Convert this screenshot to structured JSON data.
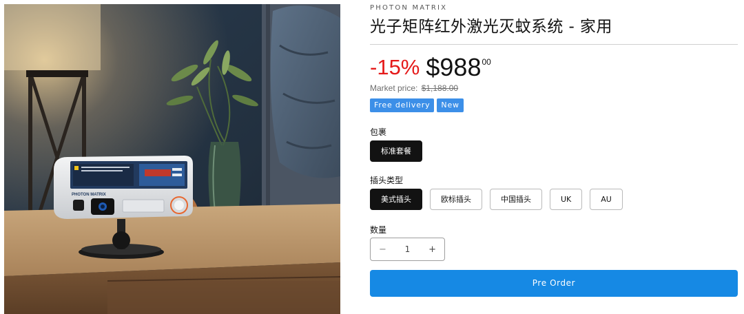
{
  "product": {
    "vendor": "PHOTON MATRIX",
    "title": "光子矩阵红外激光灭蚊系统 - 家用",
    "image_alt": "Photon Matrix device on a bedside table",
    "device_brand_text": "PHOTON MATRIX"
  },
  "price": {
    "discount": "-15%",
    "amount": "$988",
    "cents": "00",
    "market_label": "Market price:",
    "market_value": "$1,188.00"
  },
  "badges": [
    "Free delivery",
    "New"
  ],
  "options": {
    "package": {
      "label": "包裹",
      "values": [
        "标准套餐"
      ],
      "selected": "标准套餐"
    },
    "plug": {
      "label": "插头类型",
      "values": [
        "美式插头",
        "欧标插头",
        "中国插头",
        "UK",
        "AU"
      ],
      "selected": "美式插头"
    }
  },
  "quantity": {
    "label": "数量",
    "value": "1",
    "minus": "−",
    "plus": "+"
  },
  "cta": {
    "label": "Pre Order"
  },
  "colors": {
    "sale_red": "#e51a1a",
    "badge_blue": "#3c8fe8",
    "button_blue": "#1689e4",
    "selected_pill": "#121212"
  }
}
